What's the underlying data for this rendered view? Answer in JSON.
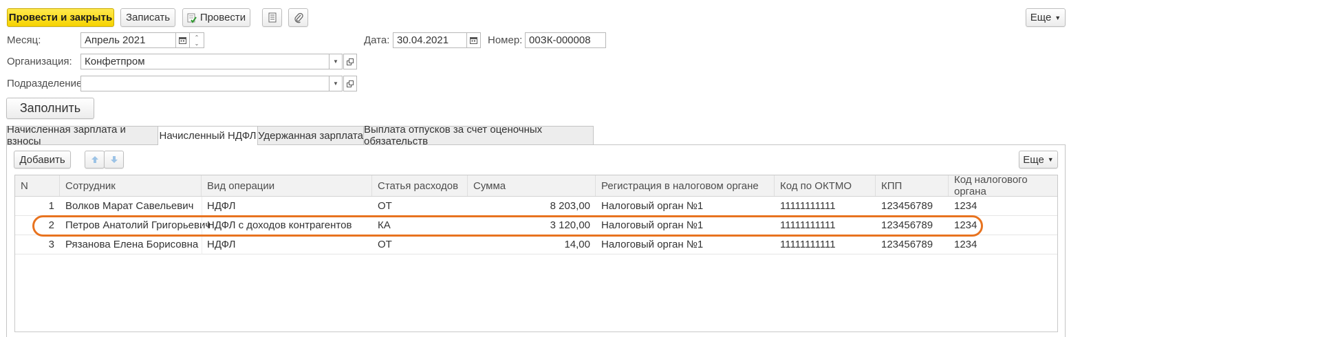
{
  "toolbar": {
    "post_close": "Провести и закрыть",
    "save": "Записать",
    "post": "Провести",
    "more": "Еще"
  },
  "form": {
    "month_label": "Месяц:",
    "month_value": "Апрель 2021",
    "date_label": "Дата:",
    "date_value": "30.04.2021",
    "number_label": "Номер:",
    "number_value": "00ЗК-000008",
    "org_label": "Организация:",
    "org_value": "Конфетпром",
    "dept_label": "Подразделение:",
    "dept_value": "",
    "fill_button": "Заполнить"
  },
  "tabs": [
    "Начисленная зарплата и взносы",
    "Начисленный НДФЛ",
    "Удержанная зарплата",
    "Выплата отпусков за счет оценочных обязательств"
  ],
  "table_toolbar": {
    "add": "Добавить",
    "more": "Еще"
  },
  "columns": [
    "N",
    "Сотрудник",
    "Вид операции",
    "Статья расходов",
    "Сумма",
    "Регистрация в налоговом органе",
    "Код по ОКТМО",
    "КПП",
    "Код налогового органа"
  ],
  "rows": [
    [
      "1",
      "Волков Марат Савельевич",
      "НДФЛ",
      "ОТ",
      "8 203,00",
      "Налоговый орган №1",
      "11111111111",
      "123456789",
      "1234"
    ],
    [
      "2",
      "Петров Анатолий Григорьевич",
      "НДФЛ с доходов контрагентов",
      "КА",
      "3 120,00",
      "Налоговый орган №1",
      "11111111111",
      "123456789",
      "1234"
    ],
    [
      "3",
      "Рязанова Елена Борисовна",
      "НДФЛ",
      "ОТ",
      "14,00",
      "Налоговый орган №1",
      "11111111111",
      "123456789",
      "1234"
    ]
  ],
  "colors": {
    "highlight": "#e8731f",
    "accent": "#f6d300"
  }
}
